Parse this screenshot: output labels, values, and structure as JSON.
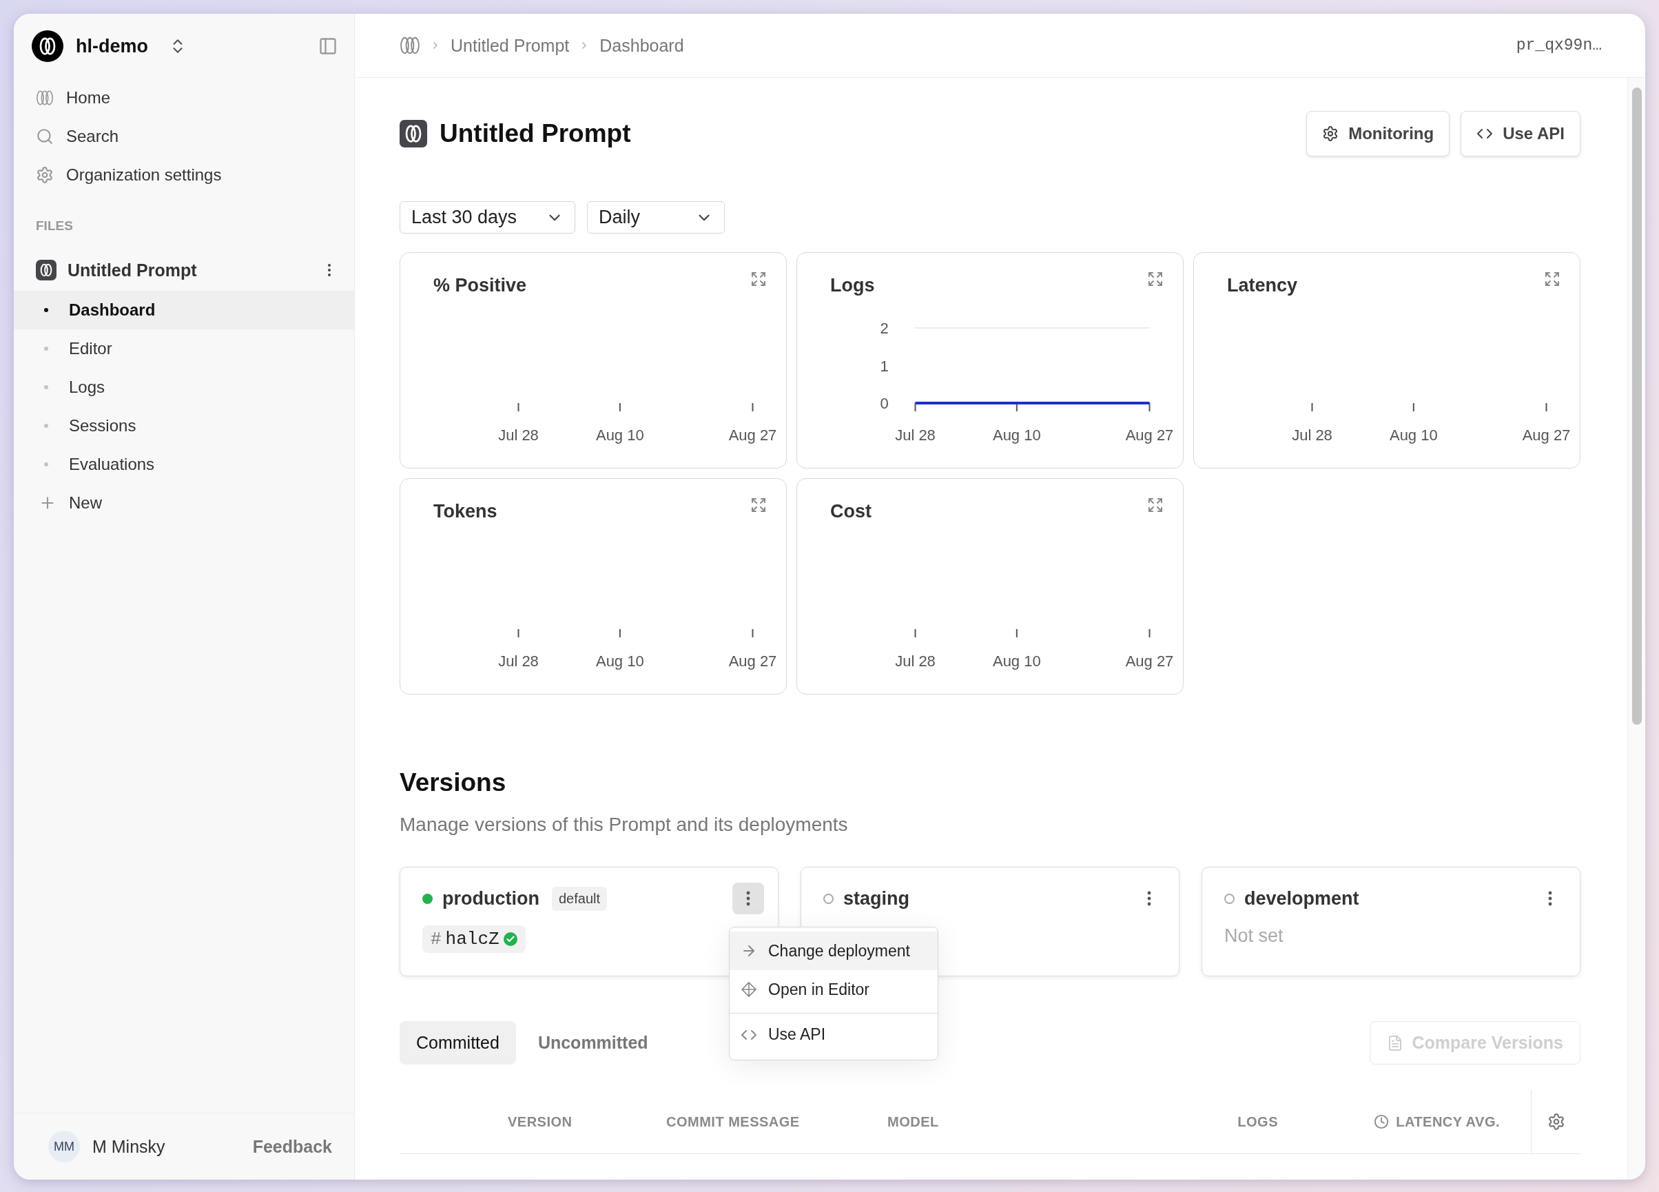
{
  "sidebar": {
    "org": {
      "name": "hl-demo"
    },
    "nav": [
      {
        "label": "Home"
      },
      {
        "label": "Search"
      },
      {
        "label": "Organization settings"
      }
    ],
    "section_label": "FILES",
    "file": {
      "name": "Untitled Prompt",
      "children": [
        {
          "label": "Dashboard",
          "selected": true
        },
        {
          "label": "Editor",
          "selected": false
        },
        {
          "label": "Logs",
          "selected": false
        },
        {
          "label": "Sessions",
          "selected": false
        },
        {
          "label": "Evaluations",
          "selected": false
        }
      ]
    },
    "new_label": "New",
    "user": {
      "initials": "MM",
      "name": "M Minsky"
    },
    "feedback": "Feedback"
  },
  "breadcrumb": [
    "Untitled Prompt",
    "Dashboard"
  ],
  "prompt_id": "pr_qx99n…",
  "header": {
    "title": "Untitled Prompt",
    "buttons": [
      "Monitoring",
      "Use API"
    ]
  },
  "filters": [
    {
      "value": "Last 30 days"
    },
    {
      "value": "Daily"
    }
  ],
  "charts": [
    {
      "title": "% Positive",
      "axis_labels": [
        "Jul 28",
        "Aug 10",
        "Aug 27"
      ]
    },
    {
      "chart_data": {
        "type": "line",
        "title": "Logs",
        "categories": [
          "Jul 28",
          null,
          null,
          null,
          null,
          null,
          null,
          null,
          null,
          null,
          null,
          null,
          null,
          "Aug 10",
          null,
          null,
          null,
          null,
          null,
          null,
          null,
          null,
          null,
          null,
          null,
          null,
          null,
          null,
          null,
          null,
          "Aug 27"
        ],
        "ylim": [
          0,
          2
        ],
        "yticks": [
          0,
          1,
          2
        ],
        "series": [
          {
            "color": "#1c2fd4",
            "values": [
              0,
              0,
              0,
              0,
              0,
              0,
              0,
              0,
              0,
              0,
              0,
              0,
              0,
              0,
              0,
              0,
              0,
              0,
              0,
              0,
              0,
              0,
              0,
              0,
              0,
              0,
              0,
              0,
              0,
              0,
              0
            ]
          }
        ]
      }
    },
    {
      "title": "Latency",
      "axis_labels": [
        "Jul 28",
        "Aug 10",
        "Aug 27"
      ]
    },
    {
      "title": "Tokens",
      "axis_labels": [
        "Jul 28",
        "Aug 10",
        "Aug 27"
      ]
    },
    {
      "title": "Cost",
      "axis_labels": [
        "Jul 28",
        "Aug 10",
        "Aug 27"
      ]
    }
  ],
  "versions": {
    "title": "Versions",
    "subtitle": "Manage versions of this Prompt and its deployments",
    "deployments": [
      {
        "name": "production",
        "active": true,
        "badge": "default",
        "version": {
          "prefix": "#",
          "id": "halcZ",
          "verified": true
        },
        "menu_open": true
      },
      {
        "name": "staging",
        "active": false,
        "menu_open": false
      },
      {
        "name": "development",
        "active": false,
        "status_text": "Not set",
        "menu_open": false
      }
    ],
    "menu": {
      "items": [
        {
          "label": "Change deployment",
          "highlighted": true,
          "divider_before": false
        },
        {
          "label": "Open in Editor",
          "highlighted": false,
          "divider_before": false
        },
        {
          "label": "Use API",
          "highlighted": false,
          "divider_before": true
        }
      ]
    },
    "tabs": [
      {
        "label": "Committed",
        "selected": true
      },
      {
        "label": "Uncommitted",
        "selected": false
      }
    ],
    "compare_button": {
      "label": "Compare Versions",
      "disabled": true
    },
    "table": {
      "columns": [
        "VERSION",
        "COMMIT MESSAGE",
        "MODEL",
        "LOGS",
        "LATENCY AVG."
      ]
    }
  }
}
